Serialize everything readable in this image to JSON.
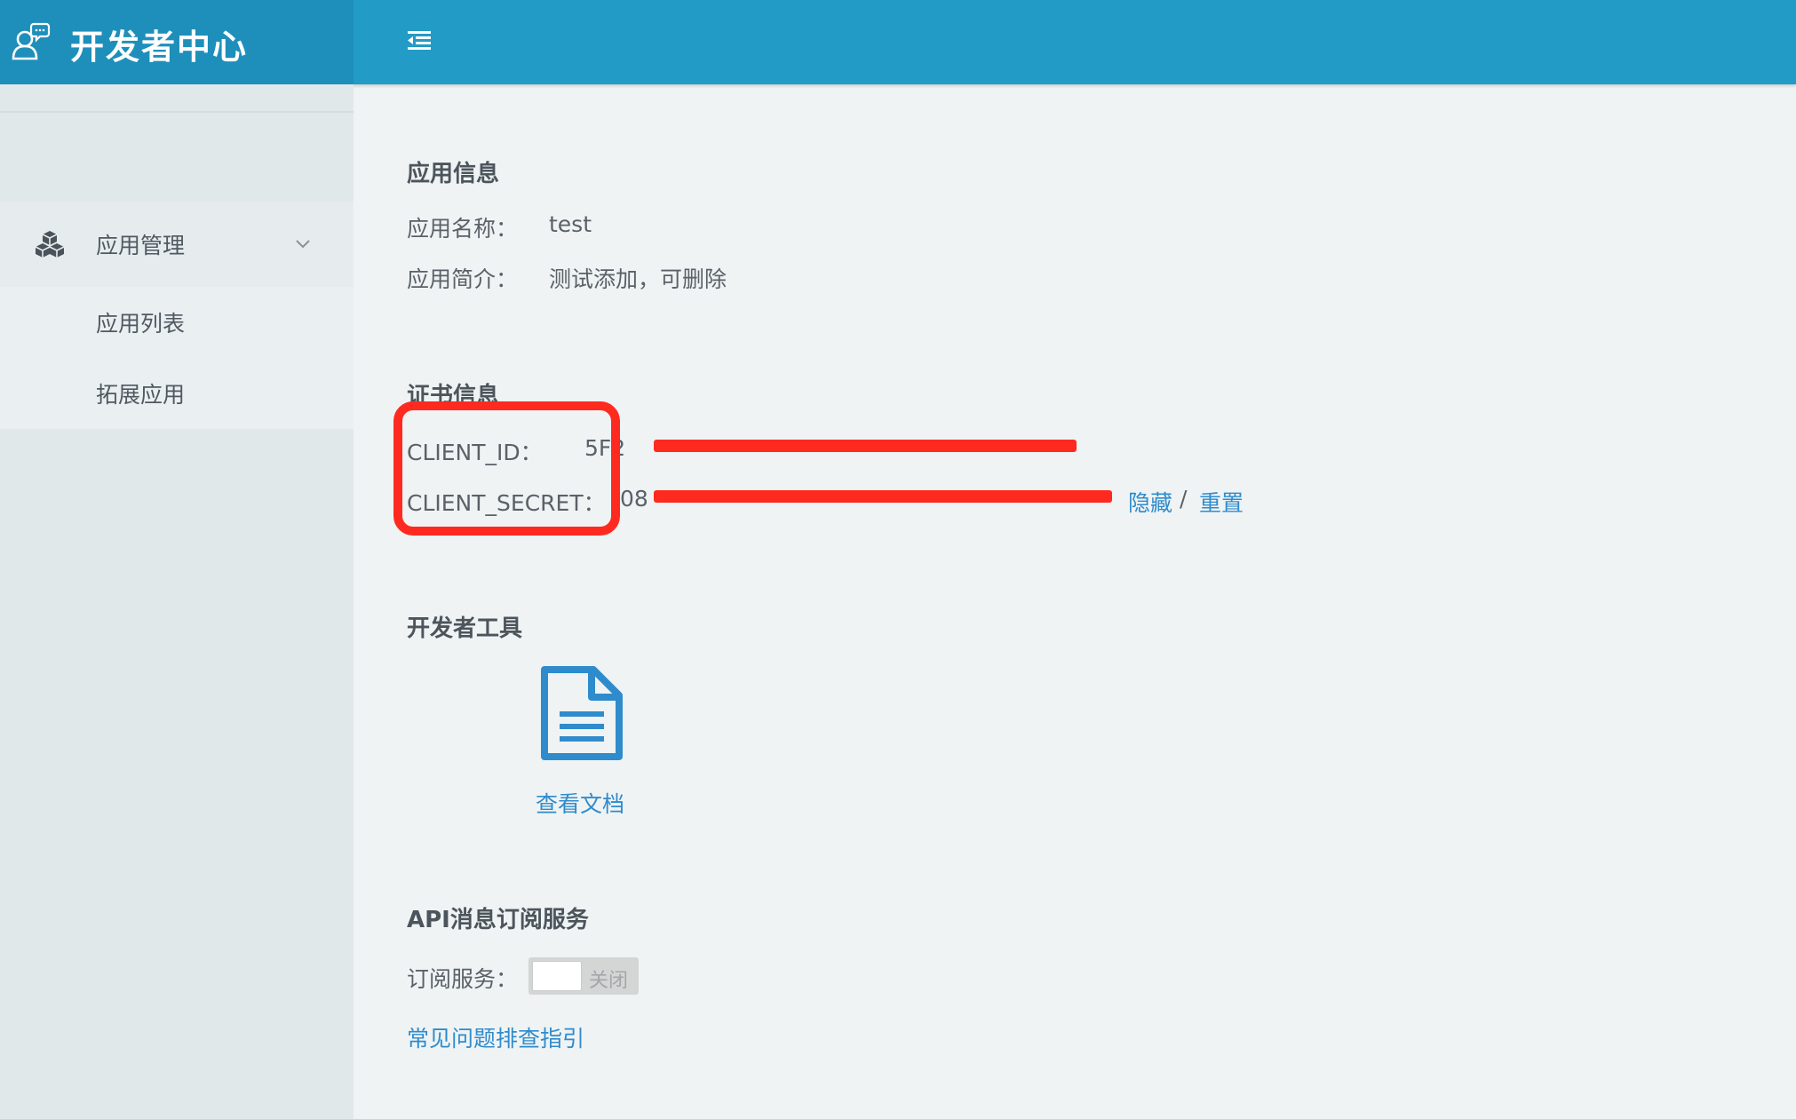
{
  "header": {
    "title": "开发者中心",
    "logo_icon": "developer-chat-icon",
    "menu_icon": "menu-collapse-icon",
    "background_color": "#229bc6"
  },
  "sidebar": {
    "group": {
      "label": "应用管理",
      "icon": "cubes-icon",
      "expanded": true
    },
    "items": [
      {
        "label": "应用列表"
      },
      {
        "label": "拓展应用"
      }
    ]
  },
  "main": {
    "app_info": {
      "title": "应用信息",
      "name_label": "应用名称：",
      "name_value": "test",
      "desc_label": "应用简介：",
      "desc_value": "测试添加，可删除"
    },
    "cert_info": {
      "title": "证书信息",
      "client_id_label": "CLIENT_ID：",
      "client_id_value": "5F2",
      "client_secret_label": "CLIENT_SECRET：",
      "client_secret_value": "08",
      "hide_link": "隐藏",
      "separator": "/",
      "reset_link": "重置"
    },
    "dev_tools": {
      "title": "开发者工具",
      "doc_label": "查看文档",
      "doc_icon": "document-icon"
    },
    "api_subscription": {
      "title": "API消息订阅服务",
      "service_label": "订阅服务：",
      "toggle_text": "关闭",
      "toggle_on": false,
      "faq_link": "常见问题排查指引"
    }
  },
  "colors": {
    "link": "#2f8ccc",
    "annotation": "#ff2a1f"
  }
}
